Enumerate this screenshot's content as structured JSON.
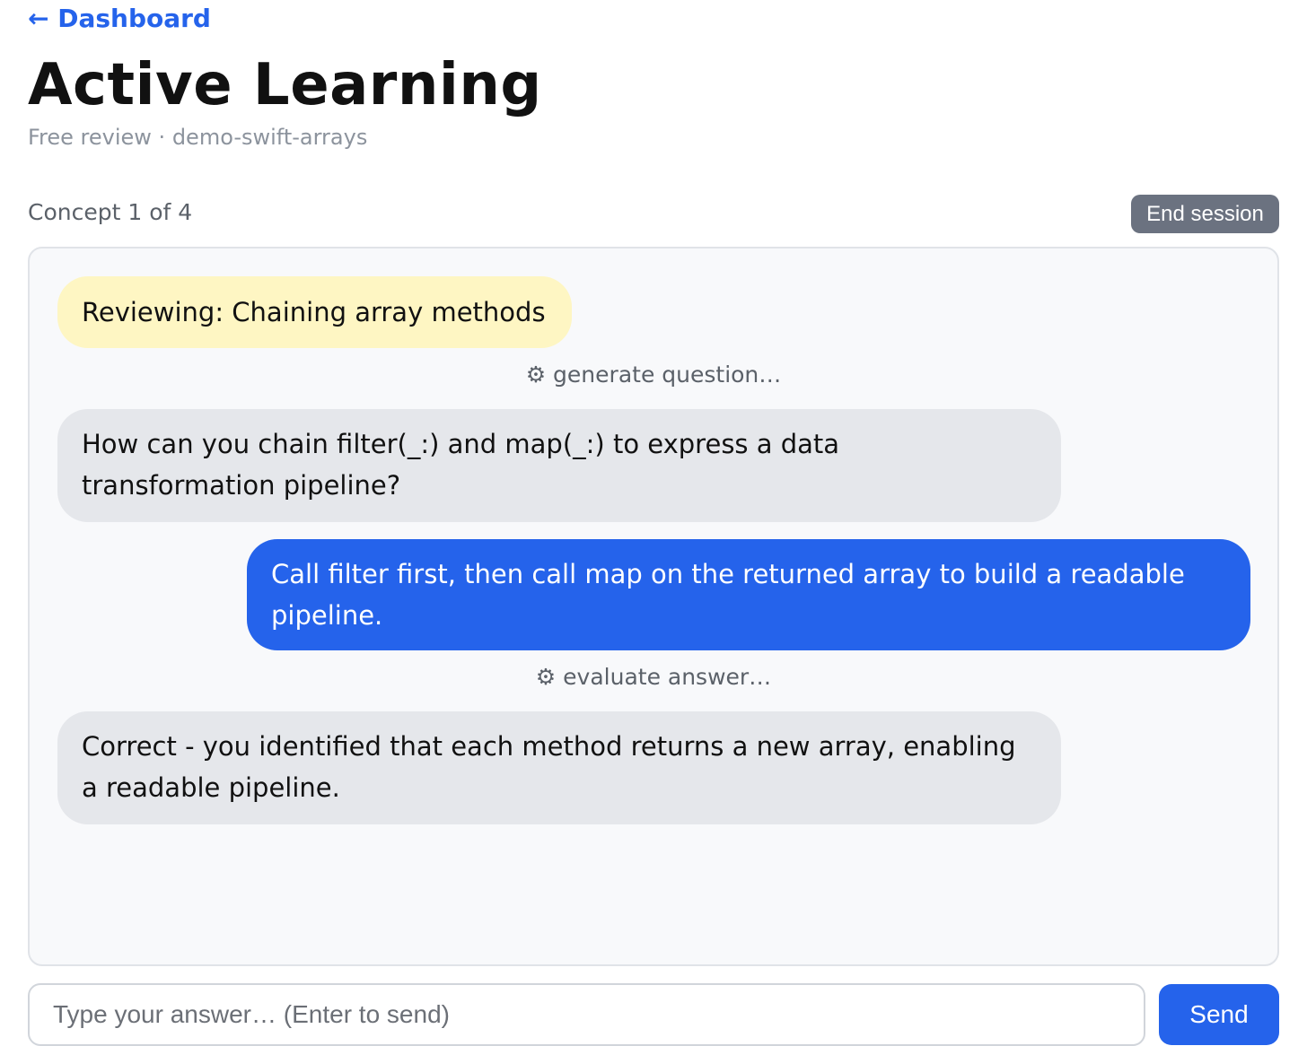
{
  "nav": {
    "back_label": "← Dashboard"
  },
  "header": {
    "title": "Active Learning",
    "subtitle": "Free review · demo-swift-arrays"
  },
  "session": {
    "concept_counter": "Concept 1 of 4",
    "end_label": "End session"
  },
  "chat": {
    "topic": "Reviewing: Chaining array methods",
    "tool_generate": "⚙ generate question…",
    "question": "How can you chain filter(_:) and map(_:) to express a data transformation pipeline?",
    "user_answer": "Call filter first, then call map on the returned array to build a readable pipeline.",
    "tool_evaluate": "⚙ evaluate answer…",
    "feedback": "Correct - you identified that each method returns a new array, enabling a readable pipeline."
  },
  "composer": {
    "placeholder": "Type your answer… (Enter to send)",
    "value": "",
    "send_label": "Send"
  },
  "colors": {
    "accent": "#2563eb",
    "topic_bg": "#fef6c3",
    "assistant_bg": "#e5e7eb",
    "end_button_bg": "#6b7280"
  }
}
